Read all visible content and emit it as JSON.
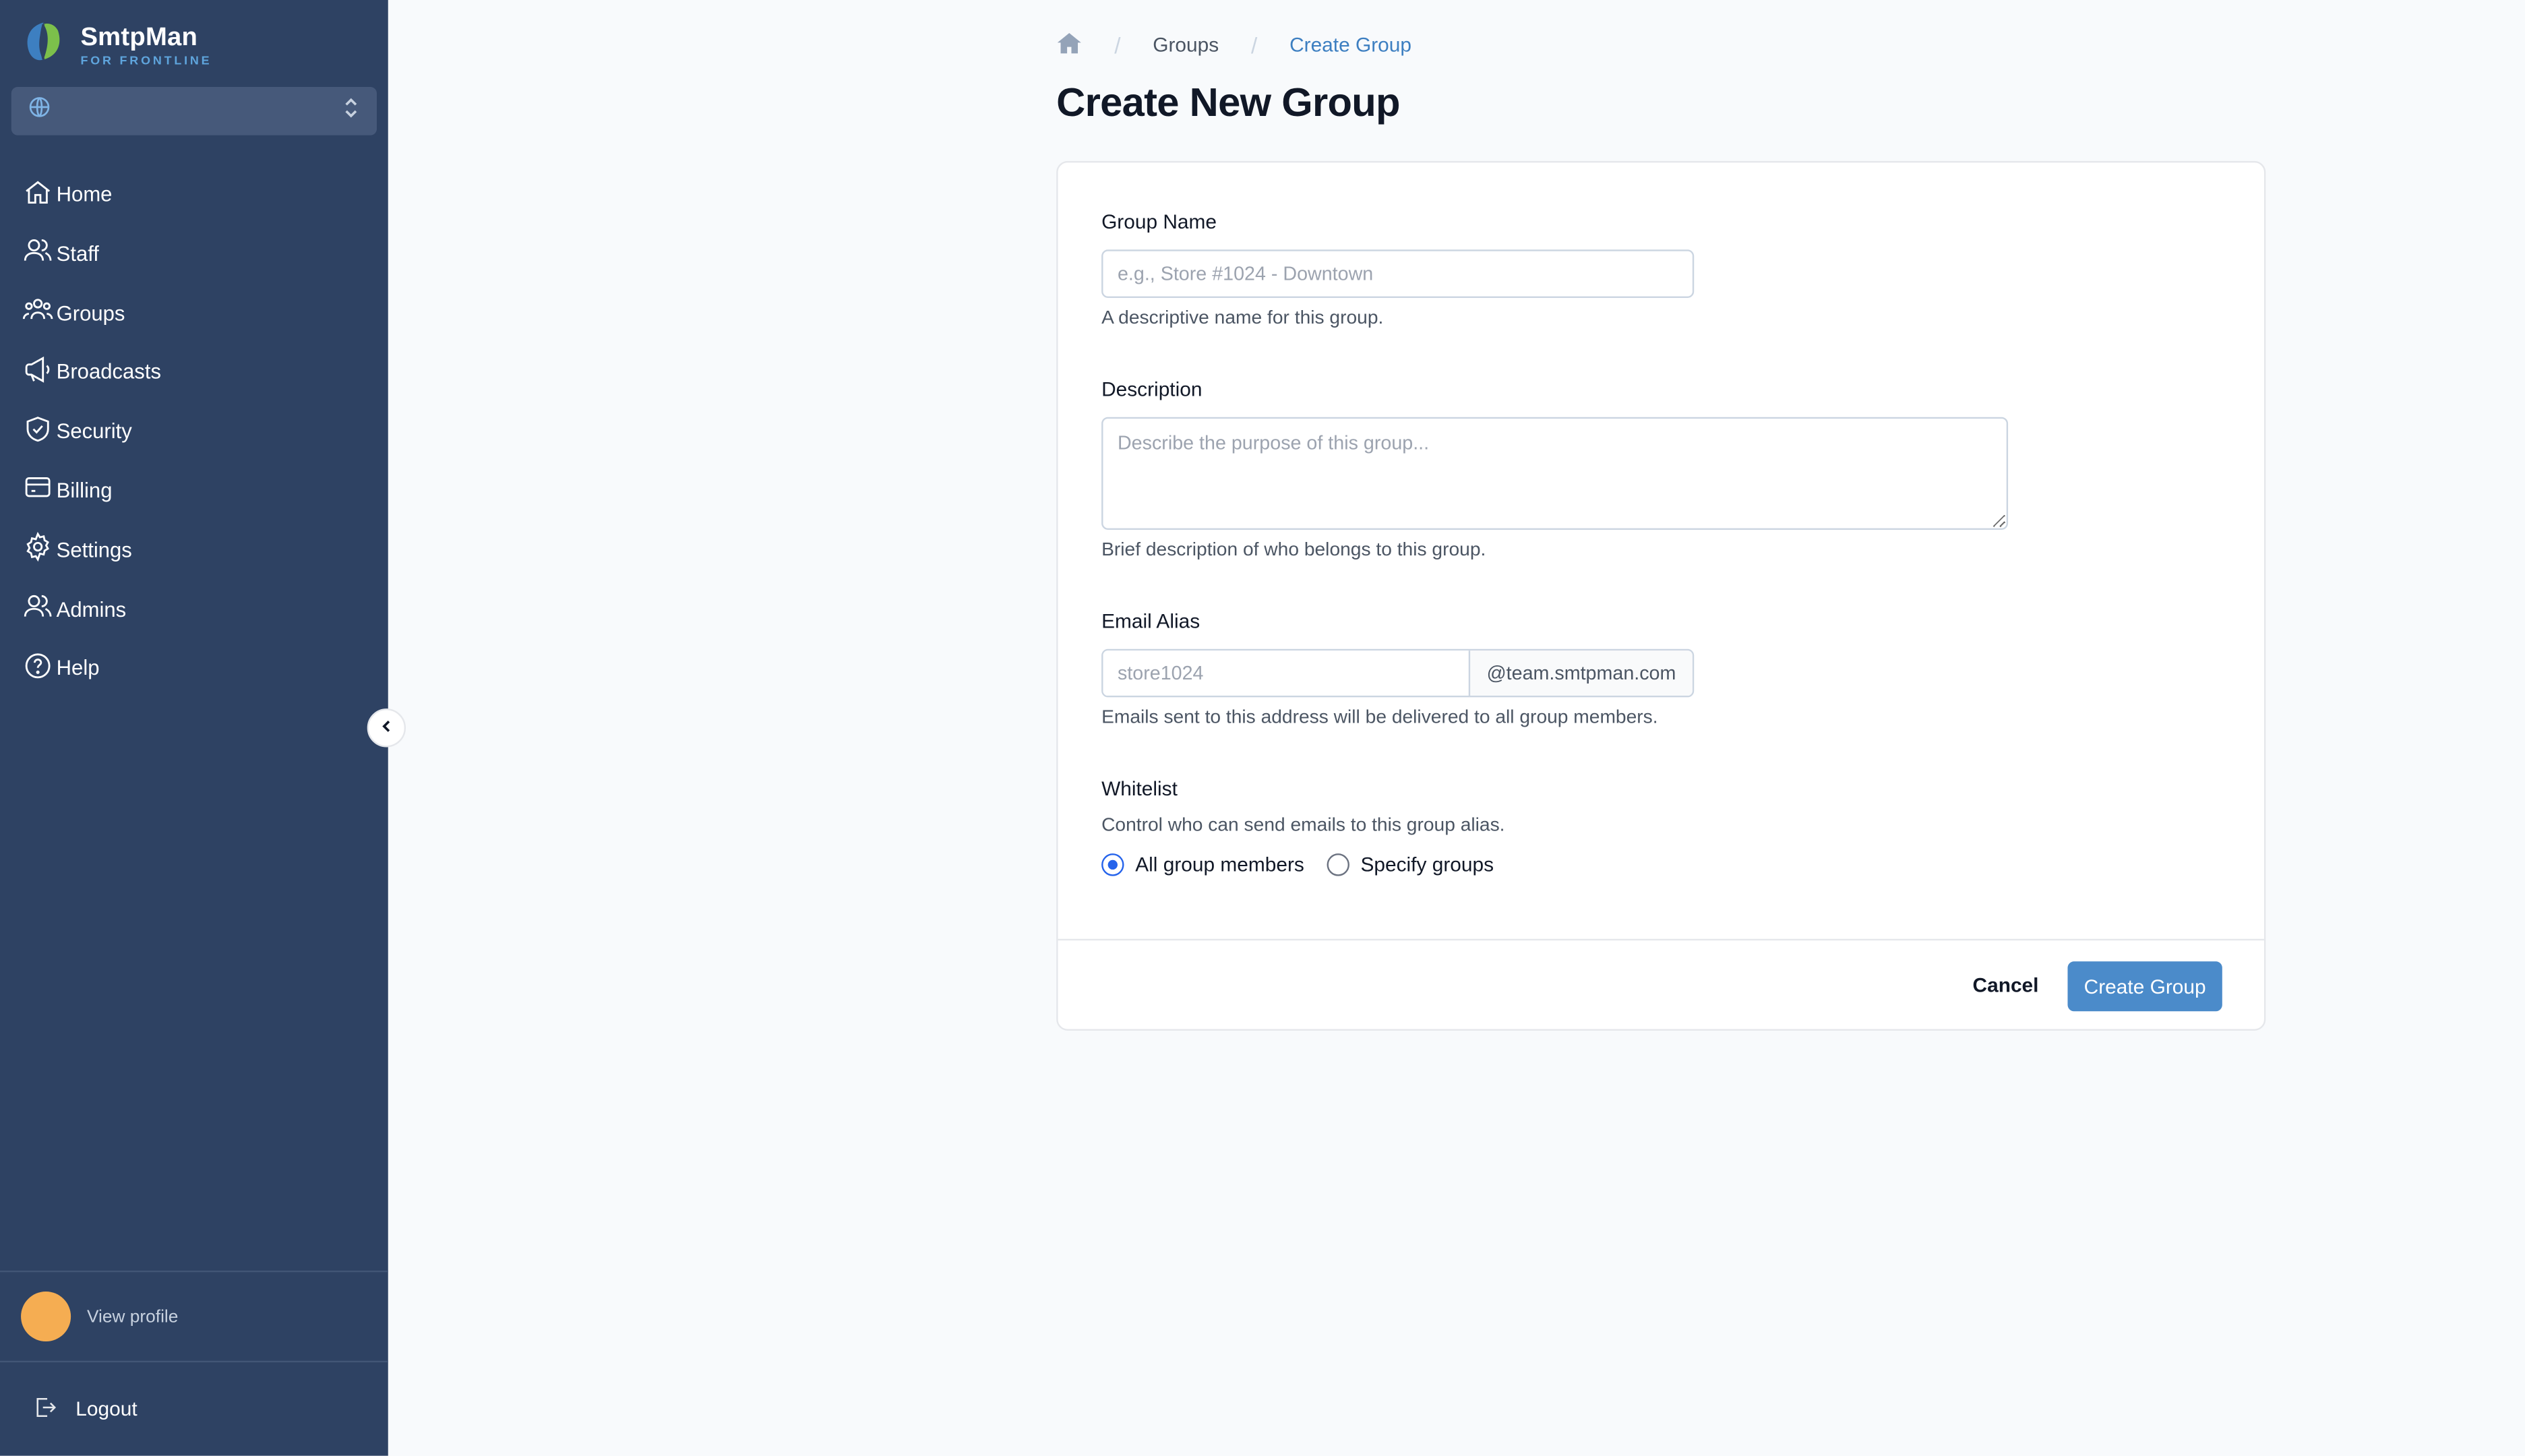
{
  "brand": {
    "name": "SmtpMan",
    "subtitle": "FOR FRONTLINE",
    "logo_icon": "smtpman-leaf-logo"
  },
  "workspace_select": {
    "value": "",
    "icon": "globe-icon"
  },
  "sidebar": {
    "items": [
      {
        "label": "Home",
        "icon": "home-icon"
      },
      {
        "label": "Staff",
        "icon": "users-icon"
      },
      {
        "label": "Groups",
        "icon": "group-icon"
      },
      {
        "label": "Broadcasts",
        "icon": "megaphone-icon"
      },
      {
        "label": "Security",
        "icon": "shield-check-icon"
      },
      {
        "label": "Billing",
        "icon": "card-icon"
      },
      {
        "label": "Settings",
        "icon": "gear-icon"
      },
      {
        "label": "Admins",
        "icon": "admin-users-icon"
      },
      {
        "label": "Help",
        "icon": "help-icon"
      }
    ],
    "profile": {
      "link": "View profile"
    },
    "logout": {
      "label": "Logout"
    }
  },
  "breadcrumb": {
    "items": [
      "Groups",
      "Create Group"
    ]
  },
  "page": {
    "title": "Create New Group"
  },
  "form": {
    "group_name": {
      "label": "Group Name",
      "value": "",
      "placeholder": "e.g., Store #1024 - Downtown",
      "help": "A descriptive name for this group."
    },
    "description": {
      "label": "Description",
      "value": "",
      "placeholder": "Describe the purpose of this group...",
      "help": "Brief description of who belongs to this group."
    },
    "email_alias": {
      "label": "Email Alias",
      "value": "",
      "placeholder": "store1024",
      "suffix": "@team.smtpman.com",
      "help": "Emails sent to this address will be delivered to all group members."
    },
    "whitelist": {
      "label": "Whitelist",
      "help": "Control who can send emails to this group alias.",
      "options": [
        "All group members",
        "Specify groups"
      ],
      "selected": "All group members"
    }
  },
  "footer": {
    "cancel_label": "Cancel",
    "create_label": "Create Group"
  },
  "colors": {
    "sidebar_bg": "#2e4263",
    "accent": "#4b8bca",
    "link": "#3d7fc1",
    "avatar": "#f5ad52"
  }
}
